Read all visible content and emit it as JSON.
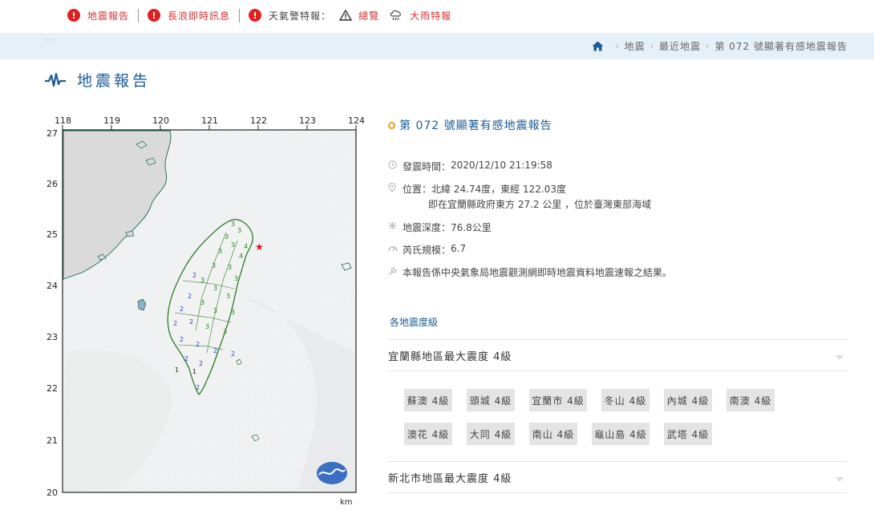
{
  "alerts": {
    "earthquake": "地震報告",
    "tsunami": "長浪即時訊息",
    "weather_label": "天氣警特報",
    "weather_colon": "：",
    "overview": "總覽",
    "heavy_rain": "大雨特報",
    "alert_colors": {
      "icon": "#e02020",
      "text": "#d63333"
    }
  },
  "breadcrumb": {
    "grip": ":::",
    "items": [
      "地震",
      "最近地震",
      "第 072 號顯著有感地震報告"
    ]
  },
  "page_title": "地震報告",
  "map": {
    "lon_labels": [
      "118",
      "119",
      "120",
      "121",
      "122",
      "123",
      "124"
    ],
    "lat_labels": [
      "27",
      "26",
      "25",
      "24",
      "23",
      "22",
      "21",
      "20"
    ],
    "unit": "km"
  },
  "report": {
    "title": "第 072 號顯著有感地震報告",
    "time_label": "發震時間：",
    "time": "2020/12/10 21:19:58",
    "location_label": "位置：",
    "location": "北緯 24.74度，東經 122.03度",
    "location_detail": "即在宜蘭縣政府東方 27.2 公里 ，位於臺灣東部海域",
    "depth_label": "地震深度：",
    "depth": "76.8公里",
    "magnitude_label": "芮氏規模：",
    "magnitude": "6.7",
    "note": "本報告係中央氣象局地震觀測網即時地震資料地震速報之結果。"
  },
  "intensity": {
    "section_title": "各地震度級",
    "regions": [
      "宜蘭縣地區最大震度 4級",
      "新北市地區最大震度 4級"
    ],
    "stations": [
      "蘇澳 4級",
      "頭城 4級",
      "宜蘭市 4級",
      "冬山 4級",
      "內城 4級",
      "南澳 4級",
      "澳花 4級",
      "大同 4級",
      "南山 4級",
      "龜山島 4級",
      "武塔 4級"
    ]
  },
  "colors": {
    "title_blue": "#1d5b97",
    "breadcrumb_bg": "#e6f0f8",
    "station_bg": "#e4e4e4",
    "title_ring": "#e8a21a",
    "epicenter": "#e01010",
    "intensity_3": "#1c8a1c",
    "intensity_2": "#2244cc"
  }
}
